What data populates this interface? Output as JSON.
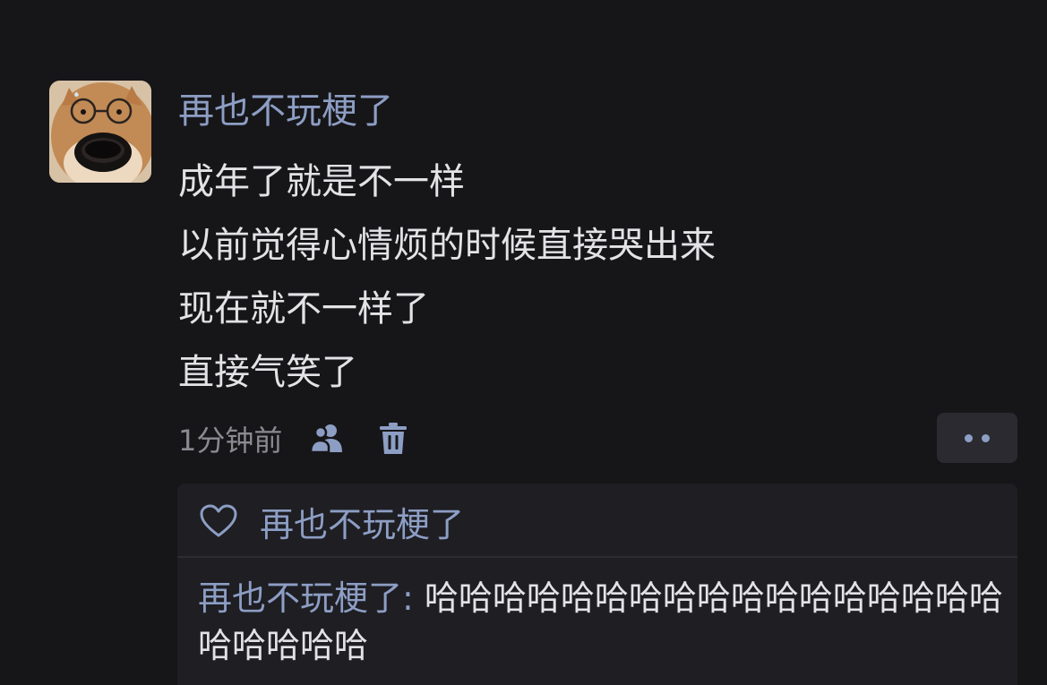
{
  "post": {
    "author": "再也不玩梗了",
    "lines": [
      "成年了就是不一样",
      "以前觉得心情烦的时候直接哭出来",
      "现在就不一样了",
      "直接气笑了"
    ],
    "time": "1分钟前",
    "icons": {
      "visibility": "friends-icon",
      "delete": "trash-icon",
      "more": "more-dots-icon"
    }
  },
  "likes": {
    "icon": "heart-icon",
    "name": "再也不玩梗了"
  },
  "comments": [
    {
      "author": "再也不玩梗了:",
      "text": " 哈哈哈哈哈哈哈哈哈哈哈哈哈哈哈哈哈哈哈哈哈哈"
    }
  ],
  "colors": {
    "background": "#161619",
    "name_blue": "#8d9ec4",
    "text": "#e3e3e6",
    "muted": "#8a8a91",
    "panel": "#1e1e23"
  }
}
